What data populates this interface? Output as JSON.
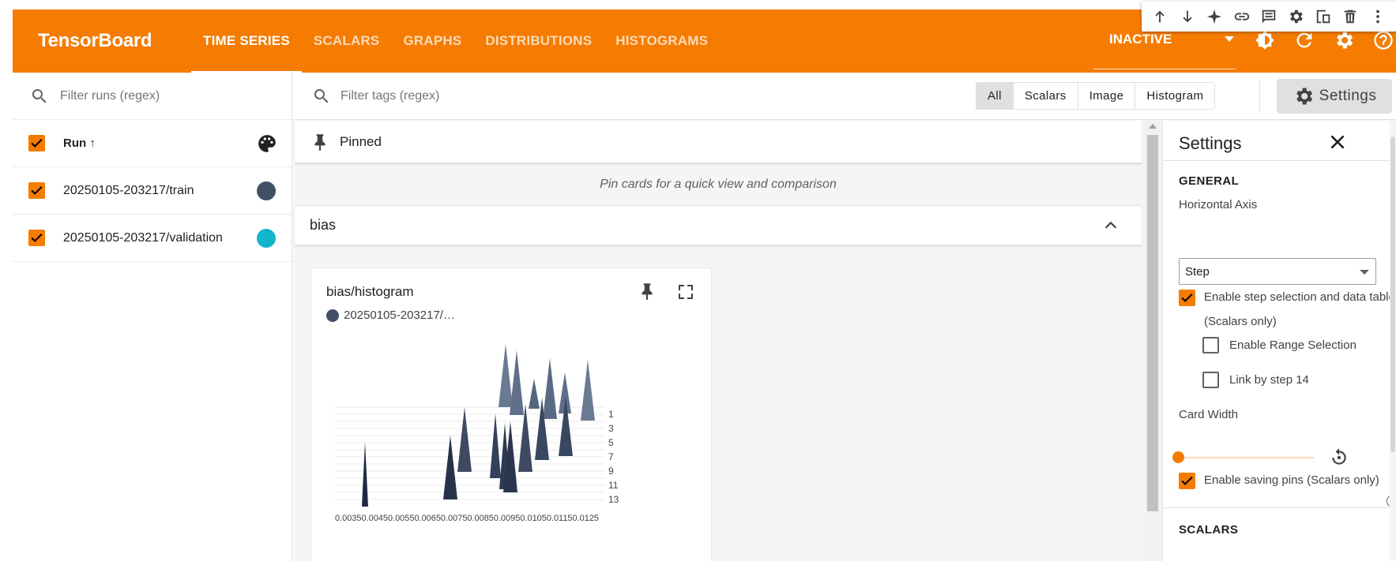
{
  "cell_toolbar": {
    "icons": [
      "arrow-up-icon",
      "arrow-down-icon",
      "sparkle-icon",
      "link-icon",
      "comment-icon",
      "gear-icon",
      "mirror-cell-icon",
      "trash-icon",
      "more-vert-icon"
    ]
  },
  "header": {
    "brand": "TensorBoard",
    "tabs": [
      "TIME SERIES",
      "SCALARS",
      "GRAPHS",
      "DISTRIBUTIONS",
      "HISTOGRAMS"
    ],
    "active_tab": "TIME SERIES",
    "plugin_select": "INACTIVE",
    "icons": [
      "dark-mode-icon",
      "reload-icon",
      "settings-icon",
      "help-icon"
    ],
    "color": "#f57c00"
  },
  "runs": {
    "filter_placeholder": "Filter runs (regex)",
    "header_label": "Run ↑",
    "items": [
      {
        "name": "20250105-203217/train",
        "color": "#425066",
        "checked": true
      },
      {
        "name": "20250105-203217/validation",
        "color": "#12b5cb",
        "checked": true
      }
    ]
  },
  "main": {
    "tag_filter_placeholder": "Filter tags (regex)",
    "type_toggle": [
      "All",
      "Scalars",
      "Image",
      "Histogram"
    ],
    "type_selected": "All",
    "settings_button": "Settings",
    "pinned_title": "Pinned",
    "pinned_empty": "Pin cards for a quick view and comparison",
    "group_title": "bias",
    "card": {
      "title": "bias/histogram",
      "run_label": "20250105-203217/…",
      "y_ticks": [
        "1",
        "3",
        "5",
        "7",
        "9",
        "11",
        "13"
      ],
      "x_ticks_text": "0.00350.00450.00550.00650.00750.00850.00950.01050.01150.0125"
    }
  },
  "settings": {
    "title": "Settings",
    "general_section": "GENERAL",
    "horizontal_axis_label": "Horizontal Axis",
    "horizontal_axis_value": "Step",
    "enable_step_selection": "Enable step selection and data table",
    "scalars_only_note": "(Scalars only)",
    "enable_range_selection": "Enable Range Selection",
    "link_by_step": "Link by step 14",
    "card_width_label": "Card Width",
    "card_width_level": 0,
    "enable_saving_pins": "Enable saving pins (Scalars only)",
    "scalars_section": "SCALARS",
    "checks": {
      "step_selection": true,
      "range_selection": false,
      "link_by_step": false,
      "saving_pins": true
    }
  }
}
